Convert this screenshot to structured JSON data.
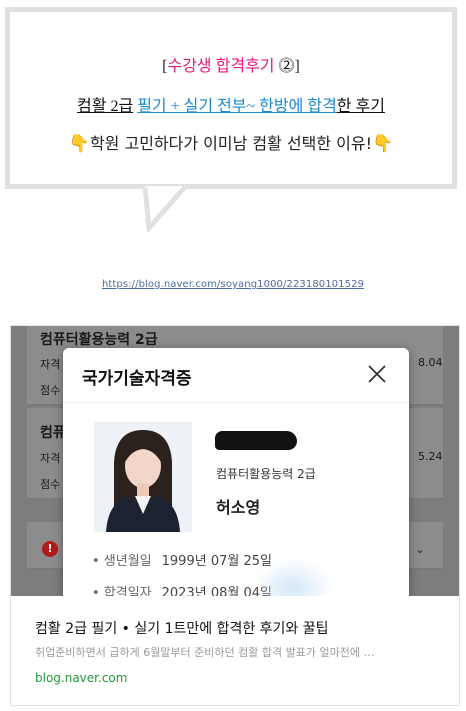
{
  "bubble": {
    "line1": {
      "open": "[",
      "text": "수강생 합격후기",
      "circled": "⓶",
      "close": "]"
    },
    "line2": {
      "part1": "컴활 2급",
      "part2": "필기 + 실기 전부~ 한방에 합격",
      "part3": "한 후기"
    },
    "line3": {
      "hand_left": "👇",
      "text": "학원 고민하다가 이미남 컴활 선택한 이유!",
      "hand_right": "👇"
    }
  },
  "link": "https://blog.naver.com/soyang1000/223180101529",
  "preview": {
    "background": {
      "row1_title": "컴퓨터활용능력 2급",
      "row1_label": "자격",
      "row1_label2": "점수",
      "row1_right": "8.04",
      "row2_title": "컴퓨",
      "row2_label": "자격",
      "row2_label2": "점수",
      "row2_right": "5.24"
    },
    "modal": {
      "title": "국가기술자격증",
      "cert_kind": "컴퓨터활용능력 2급",
      "name": "허소영",
      "birth_label": "• 생년월일",
      "birth_value": "1999년 07월 25일",
      "pass_label": "• 합격일자",
      "pass_value": "2023년 08월 04일"
    },
    "title": "컴활 2급 필기 • 실기 1트만에 합격한 후기와 꿀팁",
    "description": "취업준비하면서 급하게 6월말부터 준비하던 컴활 합격 발표가 얼마전에 …",
    "domain": "blog.naver.com"
  }
}
